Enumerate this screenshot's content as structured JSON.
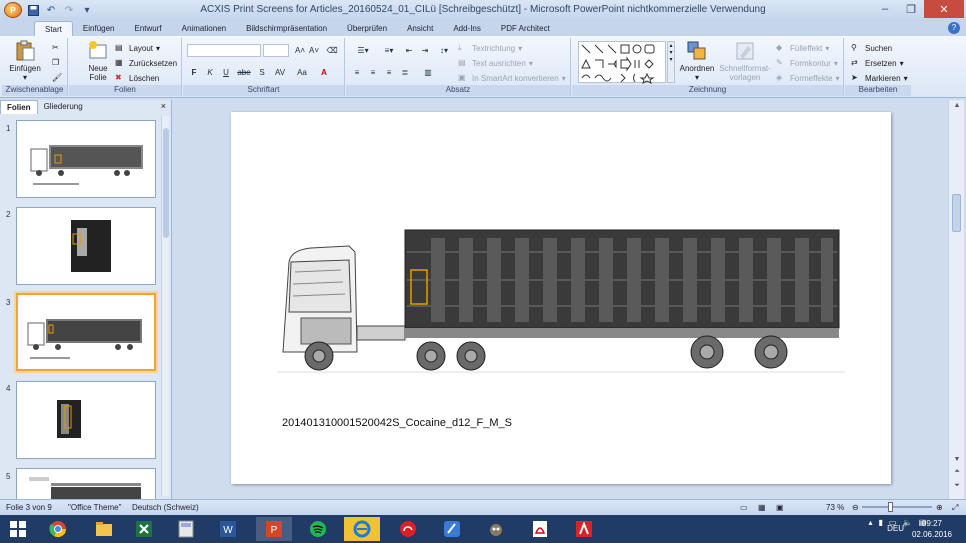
{
  "window": {
    "title": "ACXIS Print Screens for Articles_20160524_01_CILü [Schreibgeschützt] - Microsoft PowerPoint nichtkommerzielle Verwendung"
  },
  "tabs": [
    "Start",
    "Einfügen",
    "Entwurf",
    "Animationen",
    "Bildschirmpräsentation",
    "Überprüfen",
    "Ansicht",
    "Add-Ins",
    "PDF Architect"
  ],
  "ribbon": {
    "clipboard": {
      "label": "Zwischenablage",
      "paste": "Einfügen"
    },
    "slides": {
      "label": "Folien",
      "new_slide_1": "Neue",
      "new_slide_2": "Folie",
      "layout": "Layout",
      "reset": "Zurücksetzen",
      "delete": "Löschen"
    },
    "font": {
      "label": "Schriftart",
      "bold": "F",
      "italic": "K",
      "underline": "U",
      "strike": "abe",
      "shadow": "S",
      "spacing": "AV",
      "case": "Aa",
      "color": "A"
    },
    "paragraph": {
      "label": "Absatz",
      "text_direction": "Textrichtung",
      "align_text": "Text ausrichten",
      "smartart": "In SmartArt konvertieren"
    },
    "drawing": {
      "label": "Zeichnung",
      "arrange_1": "Anordnen",
      "quickstyles_1": "Schnellformat-",
      "quickstyles_2": "vorlagen",
      "fill": "Fülleffekt",
      "outline": "Formkontur",
      "effects": "Formeffekte"
    },
    "editing": {
      "label": "Bearbeiten",
      "find": "Suchen",
      "replace": "Ersetzen",
      "select": "Markieren"
    }
  },
  "left_panel": {
    "tab_slides": "Folien",
    "tab_outline": "Gliederung",
    "close": "×",
    "slides": [
      {
        "num": "1"
      },
      {
        "num": "2"
      },
      {
        "num": "3"
      },
      {
        "num": "4"
      },
      {
        "num": "5"
      }
    ]
  },
  "slide": {
    "caption": "201401310001520042S_Cocaine_d12_F_M_S"
  },
  "statusbar": {
    "slide_info": "Folie 3 von 9",
    "theme": "\"Office Theme\"",
    "language": "Deutsch (Schweiz)",
    "zoom": "73 %"
  },
  "taskbar": {
    "lang": "DEU",
    "time": "09:27",
    "date": "02.06.2016"
  }
}
